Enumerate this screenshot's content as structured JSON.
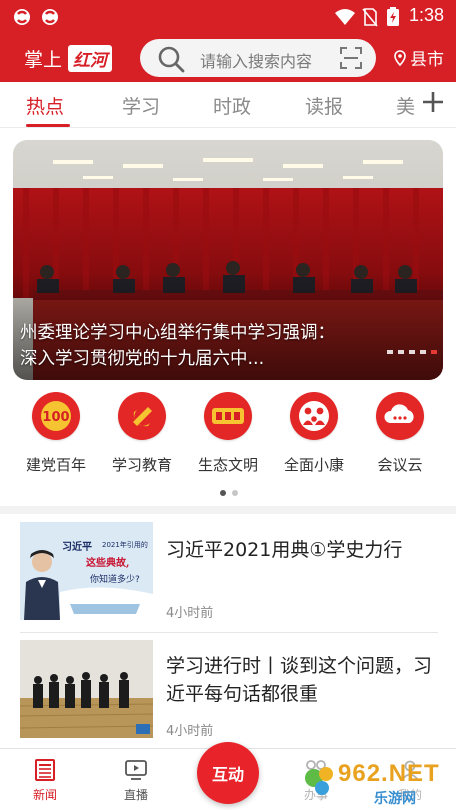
{
  "status_bar": {
    "time": "1:38"
  },
  "header": {
    "logo_prefix": "掌上",
    "logo_brand": "红河",
    "search_placeholder": "请输入搜索内容",
    "city_label": "县市"
  },
  "tabs": [
    {
      "label": "热点",
      "active": true
    },
    {
      "label": "学习",
      "active": false
    },
    {
      "label": "时政",
      "active": false
    },
    {
      "label": "读报",
      "active": false
    },
    {
      "label": "美",
      "active": false
    }
  ],
  "banner": {
    "caption": "州委理论学习中心组举行集中学习强调：深入学习贯彻党的十九届六中...",
    "page_index": 5,
    "page_count": 5
  },
  "shortcuts": [
    {
      "label": "建党百年",
      "icon": "party-100-icon"
    },
    {
      "label": "学习教育",
      "icon": "party-emblem-icon"
    },
    {
      "label": "生态文明",
      "icon": "paitou-bing-icon"
    },
    {
      "label": "全面小康",
      "icon": "family-icon"
    },
    {
      "label": "会议云",
      "icon": "cloud-icon"
    }
  ],
  "shortcut_pager": {
    "page_index": 1,
    "page_count": 2
  },
  "news": [
    {
      "title": "习近平2021用典①学史力行",
      "time": "4小时前",
      "thumb_text_1": "习近平",
      "thumb_text_2": "2021年引用的",
      "thumb_text_3": "这些典故,",
      "thumb_text_4": "你知道多少?"
    },
    {
      "title": "学习进行时丨谈到这个问题，习近平每句话都很重",
      "time": "4小时前"
    }
  ],
  "bottom_nav": {
    "items": [
      {
        "label": "新闻",
        "active": true
      },
      {
        "label": "直播",
        "active": false
      },
      {
        "label": "办事",
        "active": false
      },
      {
        "label": "我的",
        "active": false
      }
    ],
    "center_label": "互动"
  },
  "watermark": {
    "text": "962.NET",
    "sub": "乐游网"
  },
  "colors": {
    "brand_red": "#d71f26",
    "tab_gray": "#8a8a8a"
  }
}
